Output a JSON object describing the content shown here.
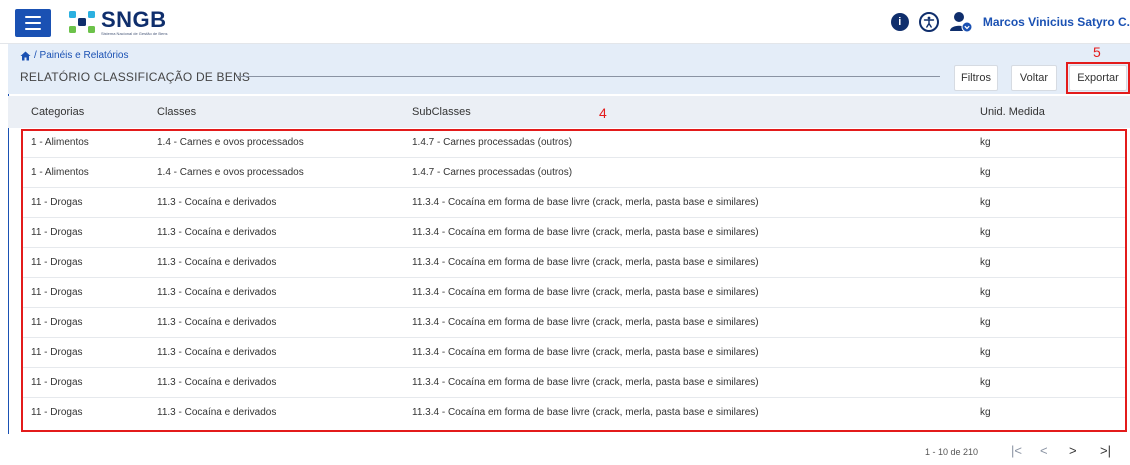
{
  "header": {
    "logo_text": "SNGB",
    "logo_subtitle": "Sistema Nacional de Gestão de Bens",
    "user_name": "Marcos Vinicius Satyro C.",
    "colors": {
      "primary": "#1a51b3",
      "navy": "#0f2e6c",
      "annotation": "#e31b1b"
    }
  },
  "breadcrumb": {
    "text": "/ Painéis e Relatórios"
  },
  "page": {
    "title": "RELATÓRIO CLASSIFICAÇÃO DE BENS"
  },
  "toolbar": {
    "filtros": "Filtros",
    "voltar": "Voltar",
    "exportar": "Exportar"
  },
  "annotations": {
    "table_marker": "4",
    "export_marker": "5"
  },
  "table": {
    "headers": [
      "Categorias",
      "Classes",
      "SubClasses",
      "Unid. Medida"
    ],
    "rows": [
      [
        "1 - Alimentos",
        "1.4 - Carnes e ovos processados",
        "1.4.7 - Carnes processadas (outros)",
        "kg"
      ],
      [
        "1 - Alimentos",
        "1.4 - Carnes e ovos processados",
        "1.4.7 - Carnes processadas (outros)",
        "kg"
      ],
      [
        "11 - Drogas",
        "11.3 - Cocaína e derivados",
        "11.3.4 - Cocaína em forma de base livre (crack, merla, pasta base e similares)",
        "kg"
      ],
      [
        "11 - Drogas",
        "11.3 - Cocaína e derivados",
        "11.3.4 - Cocaína em forma de base livre (crack, merla, pasta base e similares)",
        "kg"
      ],
      [
        "11 - Drogas",
        "11.3 - Cocaína e derivados",
        "11.3.4 - Cocaína em forma de base livre (crack, merla, pasta base e similares)",
        "kg"
      ],
      [
        "11 - Drogas",
        "11.3 - Cocaína e derivados",
        "11.3.4 - Cocaína em forma de base livre (crack, merla, pasta base e similares)",
        "kg"
      ],
      [
        "11 - Drogas",
        "11.3 - Cocaína e derivados",
        "11.3.4 - Cocaína em forma de base livre (crack, merla, pasta base e similares)",
        "kg"
      ],
      [
        "11 - Drogas",
        "11.3 - Cocaína e derivados",
        "11.3.4 - Cocaína em forma de base livre (crack, merla, pasta base e similares)",
        "kg"
      ],
      [
        "11 - Drogas",
        "11.3 - Cocaína e derivados",
        "11.3.4 - Cocaína em forma de base livre (crack, merla, pasta base e similares)",
        "kg"
      ],
      [
        "11 - Drogas",
        "11.3 - Cocaína e derivados",
        "11.3.4 - Cocaína em forma de base livre (crack, merla, pasta base e similares)",
        "kg"
      ]
    ]
  },
  "pagination": {
    "range_text": "1 - 10 de 210",
    "first_icon": "first-page-icon",
    "prev_icon": "chevron-left-icon",
    "next_icon": "chevron-right-icon",
    "last_icon": "last-page-icon"
  }
}
